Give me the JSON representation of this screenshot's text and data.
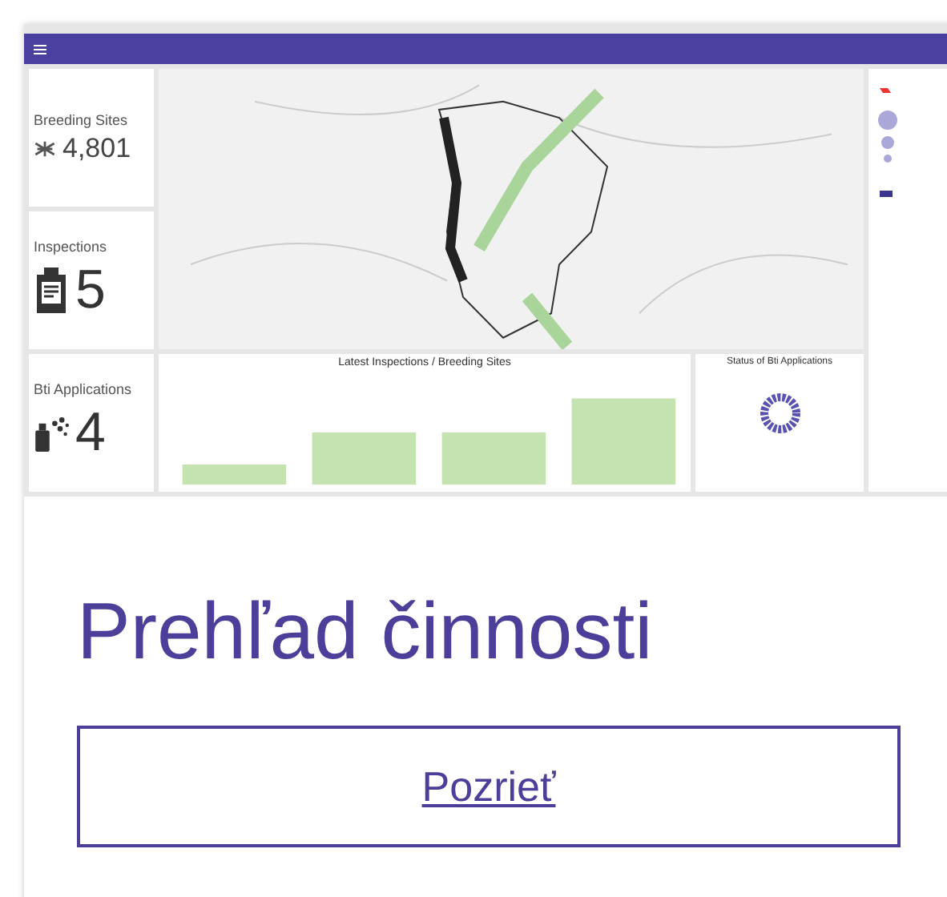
{
  "dashboard": {
    "kpis": [
      {
        "kind": "sites",
        "label": "Breeding Sites",
        "value": "4,801"
      },
      {
        "kind": "inspections",
        "label": "Inspections",
        "value": "5"
      },
      {
        "kind": "applications",
        "label": "Bti Applications",
        "value": "4"
      }
    ],
    "bar_chart_title": "Latest Inspections / Breeding Sites",
    "donut_title": "Status of Bti Applications"
  },
  "card": {
    "title": "Prehľad činnosti",
    "button": "Pozrieť"
  }
}
